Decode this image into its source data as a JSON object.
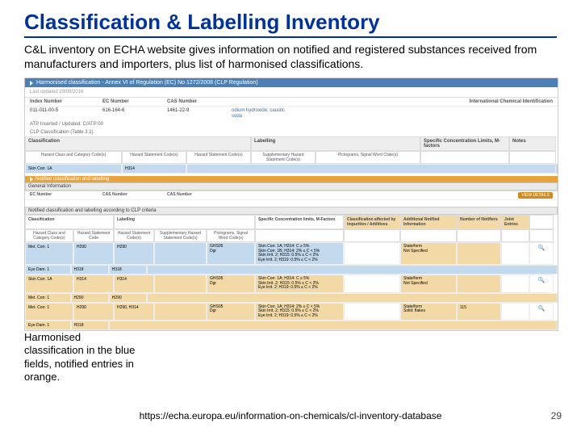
{
  "title": "Classification & Labelling Inventory",
  "intro": "C&L inventory on ECHA website gives information on notified and registered substances received from manufacturers and importers, plus list of harmonised classifications.",
  "harmBar": "Harmonised classification - Annex VI of Regulation (EC) No 1272/2008 (CLP Regulation)",
  "lastUpdLabel": "Last updated 29/09/2016",
  "idCols": [
    "Index Number",
    "EC Number",
    "CAS Number",
    "International Chemical Identification"
  ],
  "idRow": [
    "011-011-00-5",
    "616-164-6",
    "1461-22-9",
    ""
  ],
  "idRowExtra": "odium hydroxide; caustic soda",
  "atpNote1": "ATP Inserted / Updated: C/ATP 00",
  "atpNote2": "CLP Classification (Table 3.1)",
  "groupHeaders": {
    "classification": "Classification",
    "labelling": "Labelling",
    "scl": "Specific Concentration Limits, M-factors",
    "notes": "Notes"
  },
  "subHeaders": {
    "hazClass": "Hazard Class and Category Code(s)",
    "hazStmt": "Hazard Statement Code(s)",
    "hazStmt2": "Hazard Statement Code(s)",
    "supp": "Supplementary Hazard Statement Code(s)",
    "picto": "Pictograms, Signal Word Code(s)"
  },
  "harmRow": {
    "class": "Skin Corr. 1A",
    "code": "H314"
  },
  "notifBar": "Notified classification and labelling",
  "genInfoBar": "General Information",
  "genCols": [
    "EC Number",
    "CAS Number",
    "CAS Number"
  ],
  "viewBtn": "VIEW DETAILS",
  "notifSection": "Notified classification and labelling according to CLP criteria",
  "notifGroupHeaders": {
    "classification": "Classification",
    "labelling": "Labelling",
    "scl": "Specific Concentration limits, M-Factors",
    "affected": "Classification affected by Impurities / Additives",
    "addl": "Additional Notified Information",
    "notifiers": "Number of Notifiers",
    "joint": "Joint Entries"
  },
  "notifSub": {
    "hazClass": "Hazard Class and Category Code(s)",
    "hazCode": "Hazard Statement Code",
    "hazCode2": "Hazard Statement Code(s)",
    "supp": "Supplementary Hazard Statement Code(s)",
    "picto": "Pictograms, Signal Word Code(s)"
  },
  "statusChip": "State/form",
  "statusVal": "Not specified",
  "rows": [
    {
      "class": "Met. Corr. 1",
      "code": "H290",
      "code2": "H290",
      "pictos": "GHS05\nDgr",
      "scl": "Skin Corr. 1A; H314: C ≥ 5%\nSkin Corr. 1B; H314: 2% ≤ C < 5%\nSkin Irrit. 2; H315: 0.5% ≤ C < 2%\nEye Irrit. 2; H319: 0.5% ≤ C < 2%",
      "addl": "State/form\nNot Specified",
      "notifiers": "",
      "eye": "Eye Dam. 1",
      "eyec": "H318",
      "eyec2": "H318"
    },
    {
      "class1": "Skin Corr. 1A",
      "code1": "H314",
      "code1b": "H314",
      "class2": "Met. Corr. 1",
      "code2": "H290",
      "code2b": "H290",
      "pictos": "GHS05\nDgr",
      "scl": "Skin Corr. 1A; H314: C ≥ 5%\nSkin Irrit. 2; H315: 0.5% ≤ C < 2%\nEye Irrit. 2; H319: 0.5% ≤ C < 2%",
      "addl": "State/form\nNot Specified",
      "notifiers": ""
    },
    {
      "class1": "Met. Corr. 1",
      "code1": "H290",
      "code1b": "H290, H314",
      "class2": "Eye Dam. 1",
      "code2": "H318",
      "pictos": "GHS05\nDgr",
      "scl": "Skin Corr. 1A; H314: 2% ≤ C < 5%\nSkin Irrit. 2; H315: 0.5% ≤ C < 2%\nEye Irrit. 2; H319: 0.5% ≤ C < 2%",
      "addl": "State/form\nSolid: flakes",
      "notifiers": "115"
    }
  ],
  "caption": "Harmonised classification in the blue fields, notified entries in orange.",
  "url": "https://echa.europa.eu/information-on-chemicals/cl-inventory-database",
  "page": "29"
}
